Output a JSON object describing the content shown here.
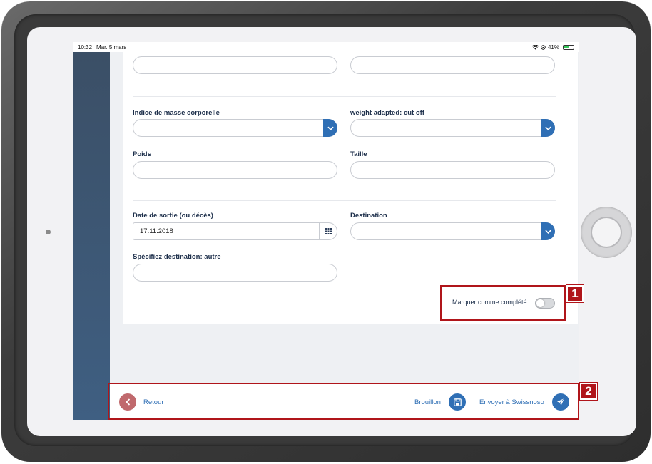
{
  "status_bar": {
    "time": "10:32",
    "date": "Mar. 5 mars",
    "battery": "41%"
  },
  "form": {
    "bmi_label": "Indice de masse corporelle",
    "weight_adapted_label": "weight adapted: cut off",
    "weight_label": "Poids",
    "height_label": "Taille",
    "discharge_date_label": "Date de sortie (ou décès)",
    "discharge_date_value": "17.11.2018",
    "destination_label": "Destination",
    "destination_other_label": "Spécifiez destination: autre",
    "complete_label": "Marquer comme complété",
    "complete_checked": false
  },
  "footer": {
    "back_label": "Retour",
    "draft_label": "Brouillon",
    "send_label": "Envoyer à Swissnoso"
  },
  "callouts": [
    "1",
    "2"
  ],
  "colors": {
    "primary": "#2f6fb5",
    "back_button": "#c0696d",
    "callout": "#b0151a",
    "sidebar": "#3f5f82"
  }
}
